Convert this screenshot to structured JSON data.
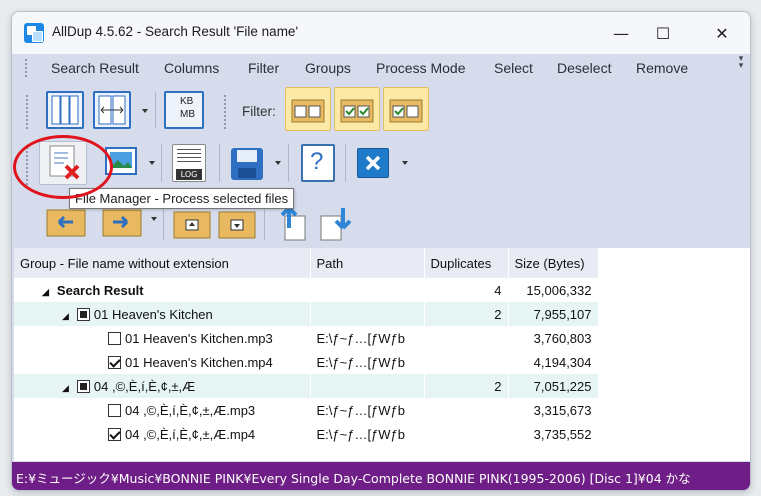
{
  "window": {
    "title": "AllDup 4.5.62 - Search Result 'File name'",
    "minimize": "—",
    "maximize": "☐",
    "close": "✕"
  },
  "menu": {
    "items": [
      "Search Result",
      "Columns",
      "Filter",
      "Groups",
      "Process Mode",
      "Select",
      "Deselect",
      "Remove"
    ],
    "overflow": "⌄"
  },
  "toolbar": {
    "filter_label": "Filter:",
    "size_unit_top": "KB",
    "size_unit_bottom": "MB",
    "log_label": "LOG",
    "help_label": "?",
    "tooltip": "File Manager - Process selected files"
  },
  "colors": {
    "status_bg": "#6e1e86",
    "group_row": "#e6f4f4",
    "highlight_circle": "#e0141c"
  },
  "grid": {
    "columns": [
      "Group - File name without extension",
      "Path",
      "Duplicates",
      "Size (Bytes)"
    ],
    "root": {
      "label": "Search Result",
      "duplicates": "4",
      "size": "15,006,332"
    },
    "groups": [
      {
        "label": "01 Heaven's Kitchen",
        "duplicates": "2",
        "size": "7,955,107",
        "files": [
          {
            "name": "01 Heaven's Kitchen.mp3",
            "path": "E:\\ƒ~ƒ…[ƒWƒb",
            "size": "3,760,803",
            "checked": false
          },
          {
            "name": "01 Heaven's Kitchen.mp4",
            "path": "E:\\ƒ~ƒ…[ƒWƒb",
            "size": "4,194,304",
            "checked": true
          }
        ]
      },
      {
        "label": "04 ,©,È,í,È,¢,±,Æ",
        "duplicates": "2",
        "size": "7,051,225",
        "files": [
          {
            "name": "04 ,©,È,í,È,¢,±,Æ.mp3",
            "path": "E:\\ƒ~ƒ…[ƒWƒb",
            "size": "3,315,673",
            "checked": false
          },
          {
            "name": "04 ,©,È,í,È,¢,±,Æ.mp4",
            "path": "E:\\ƒ~ƒ…[ƒWƒb",
            "size": "3,735,552",
            "checked": true
          }
        ]
      }
    ]
  },
  "status": {
    "path": "E:¥ミュージック¥Music¥BONNIE PINK¥Every Single Day-Complete BONNIE PINK(1995-2006) [Disc 1]¥04 かな"
  }
}
